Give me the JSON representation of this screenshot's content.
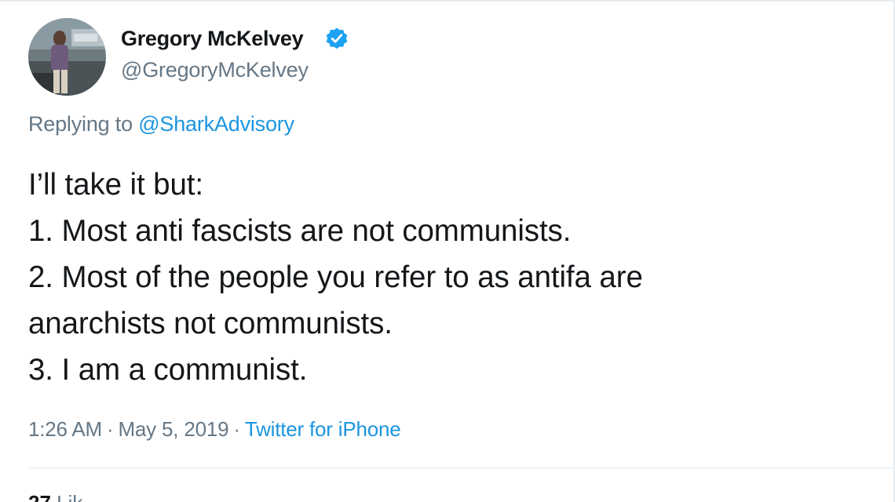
{
  "tweet": {
    "author": {
      "name": "Gregory McKelvey",
      "handle": "@GregoryMcKelvey",
      "verified": true,
      "avatar_icon": "profile-photo-icon"
    },
    "reply": {
      "prefix": "Replying to",
      "target": "@SharkAdvisory"
    },
    "text_lines": [
      "I’ll take it but:",
      "1. Most anti fascists are not communists.",
      "2. Most of the people you refer to as antifa are",
      "anarchists not communists.",
      "3. I am a communist."
    ],
    "time": "1:26 AM",
    "separator": "·",
    "date": "May 5, 2019",
    "source": "Twitter for iPhone",
    "stats_peek": {
      "count": "27",
      "label": "Lik"
    }
  },
  "colors": {
    "text_primary": "#14171a",
    "text_secondary": "#657786",
    "link": "#1b95e0",
    "verified_badge": "#1da1f2",
    "divider": "#e6ecf0"
  }
}
